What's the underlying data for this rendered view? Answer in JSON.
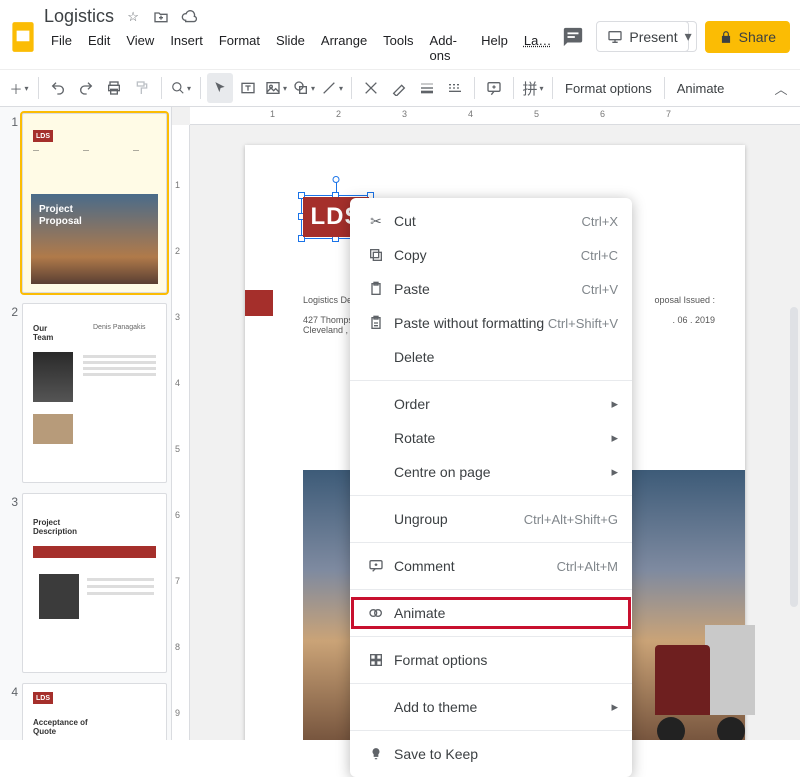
{
  "header": {
    "doc_title": "Logistics",
    "present_label": "Present",
    "share_label": "Share"
  },
  "menubar": {
    "items": [
      "File",
      "Edit",
      "View",
      "Insert",
      "Format",
      "Slide",
      "Arrange",
      "Tools",
      "Add-ons",
      "Help",
      "La…"
    ]
  },
  "toolbar": {
    "format_options": "Format options",
    "animate": "Animate"
  },
  "filmstrip": {
    "slides": [
      {
        "num": "1",
        "title": "Project\nProposal"
      },
      {
        "num": "2",
        "title": "Our\nTeam",
        "author": "Denis Panagakis"
      },
      {
        "num": "3",
        "title": "Project\nDescription"
      },
      {
        "num": "4",
        "title": "Acceptance of\nQuote"
      }
    ]
  },
  "slide": {
    "logo_text": "LDS",
    "left_meta_line1": "Logistics De",
    "left_meta_line2": "427 Thompson",
    "left_meta_line3": "Cleveland , O",
    "right_meta_line1": "oposal Issued :",
    "right_meta_line2": ". 06 . 2019"
  },
  "ruler": {
    "h": [
      "",
      "1",
      "",
      "2",
      "",
      "3",
      "",
      "4",
      "",
      "5",
      "",
      "6",
      "",
      "7"
    ],
    "v": [
      "1",
      "2",
      "3",
      "4",
      "5",
      "6",
      "7",
      "8",
      "9"
    ]
  },
  "context_menu": {
    "cut": "Cut",
    "cut_sc": "Ctrl+X",
    "copy": "Copy",
    "copy_sc": "Ctrl+C",
    "paste": "Paste",
    "paste_sc": "Ctrl+V",
    "paste_nofmt": "Paste without formatting",
    "paste_nofmt_sc": "Ctrl+Shift+V",
    "delete": "Delete",
    "order": "Order",
    "rotate": "Rotate",
    "centre": "Centre on page",
    "ungroup": "Ungroup",
    "ungroup_sc": "Ctrl+Alt+Shift+G",
    "comment": "Comment",
    "comment_sc": "Ctrl+Alt+M",
    "animate": "Animate",
    "format_options": "Format options",
    "add_theme": "Add to theme",
    "save_keep": "Save to Keep"
  }
}
